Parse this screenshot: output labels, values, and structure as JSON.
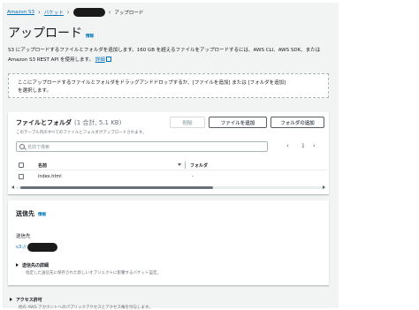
{
  "breadcrumbs": [
    {
      "label": "Amazon S3",
      "link": true
    },
    {
      "label": "バケット",
      "link": true
    },
    {
      "label": "アップロード",
      "link": false
    }
  ],
  "page": {
    "title": "アップロード",
    "info_label": "情報",
    "description": "S3 にアップロードするファイルとフォルダを追加します。160 GB を超えるファイルをアップロードするには、AWS CLI、AWS SDK、または Amazon S3 REST API を使用します。",
    "details_link": "詳細"
  },
  "dropzone": {
    "line1": "ここにアップロードするファイルとフォルダをドラッグアンドドロップするか、[ファイルを追加] または [フォルダを追加]",
    "line2": "を選択します。"
  },
  "files_panel": {
    "title": "ファイルとフォルダ",
    "count": "(1 合計, 5.1 KB)",
    "subtitle": "このテーブル内のすべてのファイルとフォルダがアップロードされます。",
    "remove_button": "削除",
    "add_files_button": "ファイルを追加",
    "add_folder_button": "フォルダの追加",
    "search_placeholder": "名前で検索",
    "pager": {
      "prev": "‹",
      "page": "1",
      "next": "›"
    },
    "columns": [
      "名前",
      "フォルダ"
    ],
    "rows": [
      {
        "name": "index.html",
        "folder": "-"
      }
    ]
  },
  "destination": {
    "title": "送信先",
    "info_label": "情報",
    "label": "送信先",
    "path_prefix": "s3://",
    "details_title": "送信先の詳細",
    "details_sub": "指定した送信先に保存された新しいオブジェクトに影響するバケット設定。"
  },
  "access": {
    "title": "アクセス許可",
    "sub": "他の AWS アカウントへのパブリックアクセスとアクセス権を付与します。"
  },
  "colors": {
    "link": "#0073bb",
    "panel_bg": "#f2f3f3",
    "text": "#16191f",
    "muted": "#687078"
  }
}
